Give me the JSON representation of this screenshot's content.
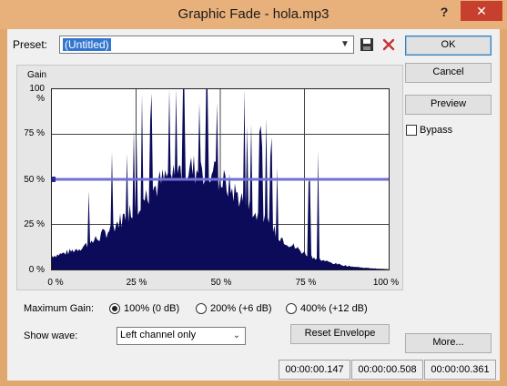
{
  "window": {
    "title": "Graphic Fade - hola.mp3",
    "help_label": "?",
    "close_label": "✕"
  },
  "preset": {
    "label": "Preset:",
    "value": "(Untitled)"
  },
  "buttons": {
    "ok": "OK",
    "cancel": "Cancel",
    "preview": "Preview",
    "more": "More...",
    "reset_envelope": "Reset Envelope"
  },
  "bypass": {
    "label": "Bypass",
    "checked": false
  },
  "graph": {
    "gain_label": "Gain",
    "y_ticks": [
      "100 %",
      "75 %",
      "50 %",
      "25 %",
      "0 %"
    ],
    "x_ticks": [
      "0 %",
      "25 %",
      "50 %",
      "75 %",
      "100 %"
    ],
    "envelope_level_percent": 50,
    "waveform_color": "#0b0b5a",
    "envelope_color": "#7070d8"
  },
  "max_gain": {
    "label": "Maximum Gain:",
    "options": [
      "100% (0 dB)",
      "200% (+6 dB)",
      "400% (+12 dB)"
    ],
    "selected_index": 0
  },
  "show_wave": {
    "label": "Show wave:",
    "value": "Left channel only"
  },
  "status": {
    "cells": [
      "00:00:00.147",
      "00:00:00.508",
      "00:00:00.361"
    ]
  }
}
